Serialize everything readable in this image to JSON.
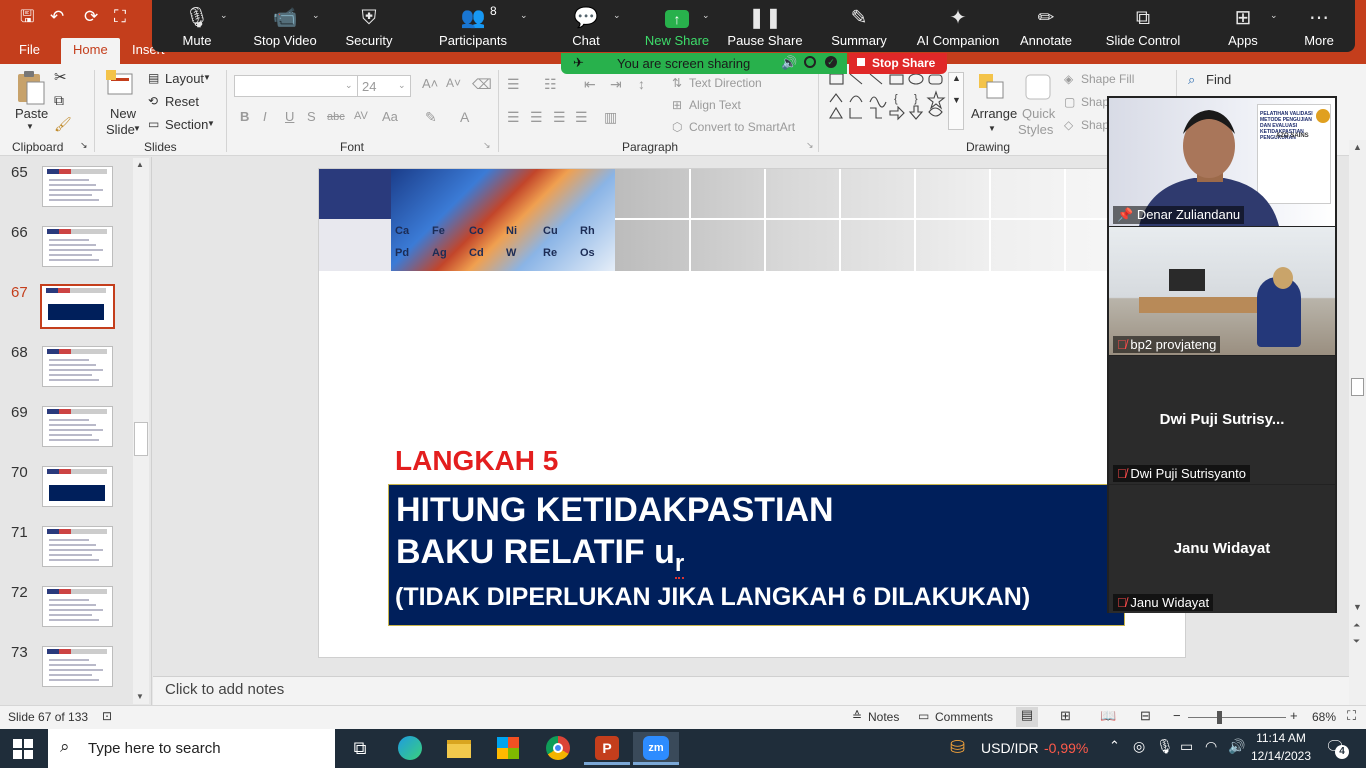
{
  "qat": {
    "save": "🖫",
    "undo": "↶",
    "redo": "⟳",
    "present": "⛶"
  },
  "ribbon_tabs": [
    "File",
    "Home",
    "Insert"
  ],
  "zoom_toolbar": {
    "mute": "Mute",
    "stop_video": "Stop Video",
    "security": "Security",
    "participants": "Participants",
    "participants_count": "8",
    "chat": "Chat",
    "new_share": "New Share",
    "pause_share": "Pause Share",
    "summary": "Summary",
    "ai_companion": "AI Companion",
    "annotate": "Annotate",
    "slide_control": "Slide Control",
    "apps": "Apps",
    "more": "More"
  },
  "sharing_banner": {
    "text": "You are screen sharing",
    "stop": "Stop Share",
    "accent": "#28b14c",
    "stop_color": "#e02828"
  },
  "clipboard": {
    "paste": "Paste",
    "label": "Clipboard"
  },
  "slides_group": {
    "new_slide_1": "New",
    "new_slide_2": "Slide",
    "layout": "Layout",
    "reset": "Reset",
    "section": "Section",
    "label": "Slides"
  },
  "font_group": {
    "font_size": "24",
    "label": "Font"
  },
  "paragraph_group": {
    "text_direction": "Text Direction",
    "align_text": "Align Text",
    "convert_smartart": "Convert to SmartArt",
    "label": "Paragraph"
  },
  "drawing_group": {
    "arrange": "Arrange",
    "quick_styles_1": "Quick",
    "quick_styles_2": "Styles",
    "shape_fill": "Shape Fill",
    "shape_outline": "Shap",
    "shape_effects": "Shap",
    "label": "Drawing"
  },
  "editing_group": {
    "find": "Find"
  },
  "thumbnails": [
    {
      "num": "65"
    },
    {
      "num": "66"
    },
    {
      "num": "67",
      "selected": true
    },
    {
      "num": "68"
    },
    {
      "num": "69"
    },
    {
      "num": "70"
    },
    {
      "num": "71"
    },
    {
      "num": "72"
    },
    {
      "num": "73"
    }
  ],
  "slide": {
    "step_label": "LANGKAH 5",
    "title_line1": "HITUNG KETIDAKPASTIAN",
    "title_line2": "BAKU RELATIF u",
    "title_subscript": "r",
    "note_line": "(TIDAK DIPERLUKAN JIKA LANGKAH 6 DILAKUKAN)",
    "step_color": "#e31e1e",
    "box_color": "#001f5b",
    "header_elements": [
      "Ca",
      "Fe",
      "Co",
      "Ni",
      "Cu",
      "Rh",
      "Pd",
      "Ag",
      "Cd",
      "W",
      "Re",
      "Os"
    ]
  },
  "notes_placeholder": "Click to add notes",
  "status": {
    "slide_info": "Slide 67 of 133",
    "notes": "Notes",
    "comments": "Comments",
    "zoom": "68%"
  },
  "video_tiles": [
    {
      "name": "Denar Zuliandanu",
      "slide_text_1": "PELATIHAN VALIDASI METODE PENGUJIAN",
      "slide_text_2": "DAN EVALUASI KETIDAKPASTIAN PENGUKURAN",
      "logo_text": "AZO SAINS"
    },
    {
      "name": "bp2 provjateng"
    },
    {
      "name": "Dwi Puji Sutrisyanto",
      "center": "Dwi  Puji  Sutrisy..."
    },
    {
      "name": "Janu Widayat",
      "center": "Janu Widayat"
    }
  ],
  "taskbar": {
    "search_placeholder": "Type here to search",
    "currency": "USD/IDR",
    "currency_change": "-0,99%",
    "currency_color": "#ff5a4a",
    "time": "11:14 AM",
    "date": "12/14/2023",
    "notifications": "4"
  }
}
